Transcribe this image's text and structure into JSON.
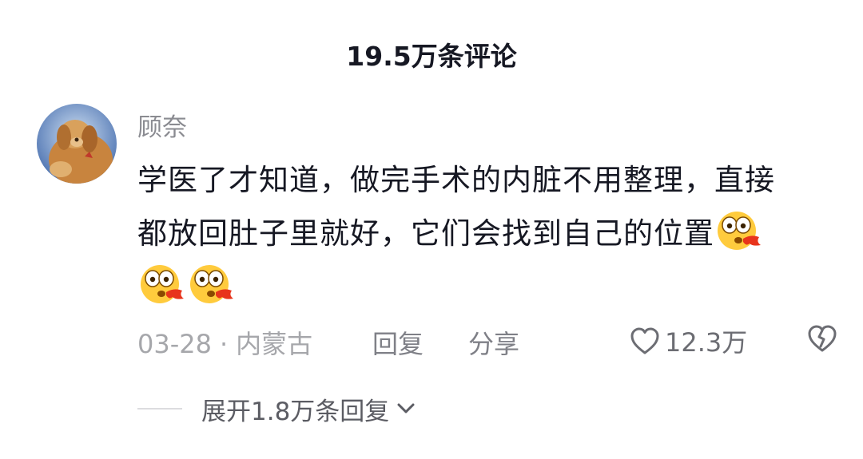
{
  "header": {
    "title": "19.5万条评论"
  },
  "comment": {
    "username": "顾奈",
    "text_line1": "学医了才知道，做完手术的内脏不用整理，直接",
    "text_line2": "都放回肚子里就好，它们会找到自己的位置",
    "emoji_icons": [
      "eyes-popping-emoji-icon",
      "eyes-popping-emoji-icon",
      "eyes-popping-emoji-icon"
    ],
    "date": "03-28",
    "separator": "·",
    "location": "内蒙古",
    "reply_label": "回复",
    "share_label": "分享",
    "like_count": "12.3万",
    "expand_label": "展开1.8万条回复"
  },
  "colors": {
    "text_primary": "#161823",
    "text_secondary": "#8a8b91",
    "text_meta": "#a6a7ab",
    "emoji_face": "#ffcb3d",
    "emoji_accent": "#e8341c"
  }
}
